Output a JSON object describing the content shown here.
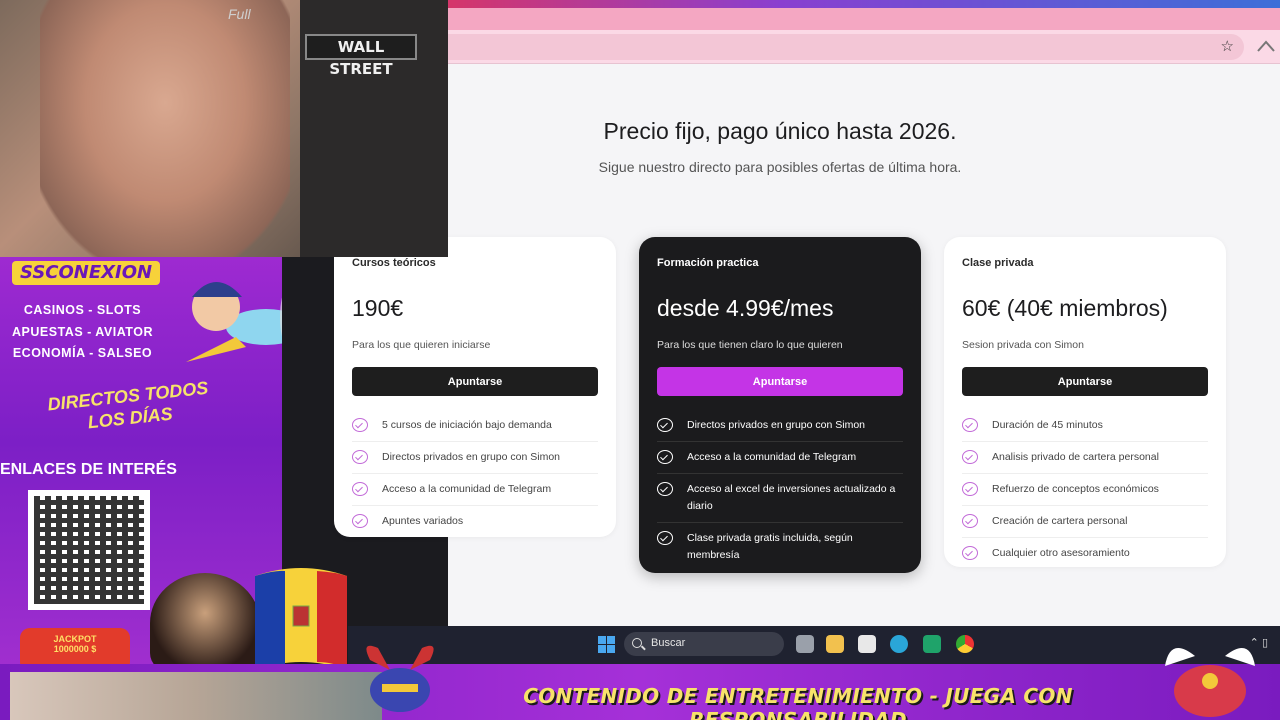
{
  "overlay": {
    "webcam_sign": "WALL STREET",
    "webcam_corner_text": "Full",
    "brand": "SSCONEXION",
    "menu": [
      "CASINOS - SLOTS",
      "APUESTAS - AVIATOR",
      "ECONOMÍA - SALSEO"
    ],
    "directos": "DIRECTOS TODOS LOS DÍAS",
    "enlaces": "ENLACES DE INTERÉS",
    "jackpot_label": "JACKPOT",
    "jackpot_amount": "1000000 $",
    "banner": "CONTENIDO DE ENTRETENIMIENTO - JUEGA CON RESPONSABILIDAD"
  },
  "page": {
    "headline": "Precio fijo, pago único hasta 2026.",
    "subhead": "Sigue nuestro directo para posibles ofertas de última hora."
  },
  "plans": [
    {
      "title": "Cursos teóricos",
      "price": "190€",
      "desc": "Para los que quieren iniciarse",
      "button": "Apuntarse",
      "features": [
        "5 cursos de iniciación bajo demanda",
        "Directos privados en grupo con Simon",
        "Acceso a la comunidad de Telegram",
        "Apuntes variados"
      ]
    },
    {
      "title": "Formación practica",
      "price": "desde 4.99€/mes",
      "desc": "Para los que tienen claro lo que quieren",
      "button": "Apuntarse",
      "features": [
        "Directos privados en grupo con Simon",
        "Acceso a la comunidad de Telegram",
        "Acceso al excel de inversiones actualizado a diario",
        "Clase privada gratis incluida, según membresía"
      ]
    },
    {
      "title": "Clase privada",
      "price": "60€ (40€ miembros)",
      "desc": "Sesion privada con Simon",
      "button": "Apuntarse",
      "features": [
        "Duración de 45 minutos",
        "Analisis privado de cartera personal",
        "Refuerzo de conceptos económicos",
        "Creación de cartera personal",
        "Cualquier otro asesoramiento"
      ]
    }
  ],
  "taskbar": {
    "search_placeholder": "Buscar"
  },
  "colors": {
    "accent": "#c434e6",
    "check": "#c26bd8",
    "dark_card": "#1b1b1d"
  }
}
